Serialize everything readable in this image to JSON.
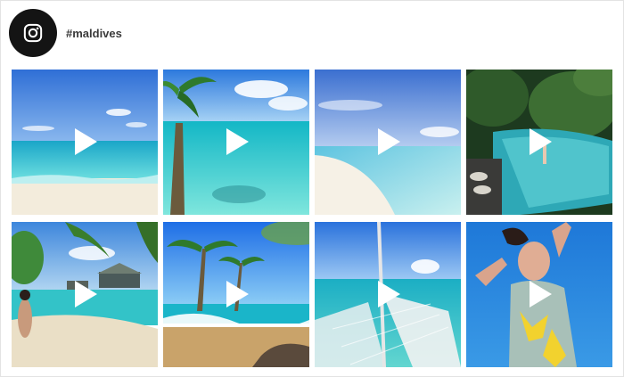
{
  "profile": {
    "hashtag": "#maldives",
    "icon": "instagram-icon"
  },
  "posts": [
    {
      "type": "video",
      "scene": "ocean-lagoon-horizon"
    },
    {
      "type": "video",
      "scene": "palm-tree-turquoise-water"
    },
    {
      "type": "video",
      "scene": "white-sand-shoreline"
    },
    {
      "type": "video",
      "scene": "infinity-pool-jungle"
    },
    {
      "type": "video",
      "scene": "beach-woman-water-villas"
    },
    {
      "type": "video",
      "scene": "palms-beach-waves"
    },
    {
      "type": "video",
      "scene": "catamaran-net-sea"
    },
    {
      "type": "video",
      "scene": "woman-underwater-pool"
    }
  ],
  "colors": {
    "avatar_bg": "#141414",
    "play_icon": "#ffffff",
    "border": "#e3e3e3"
  }
}
